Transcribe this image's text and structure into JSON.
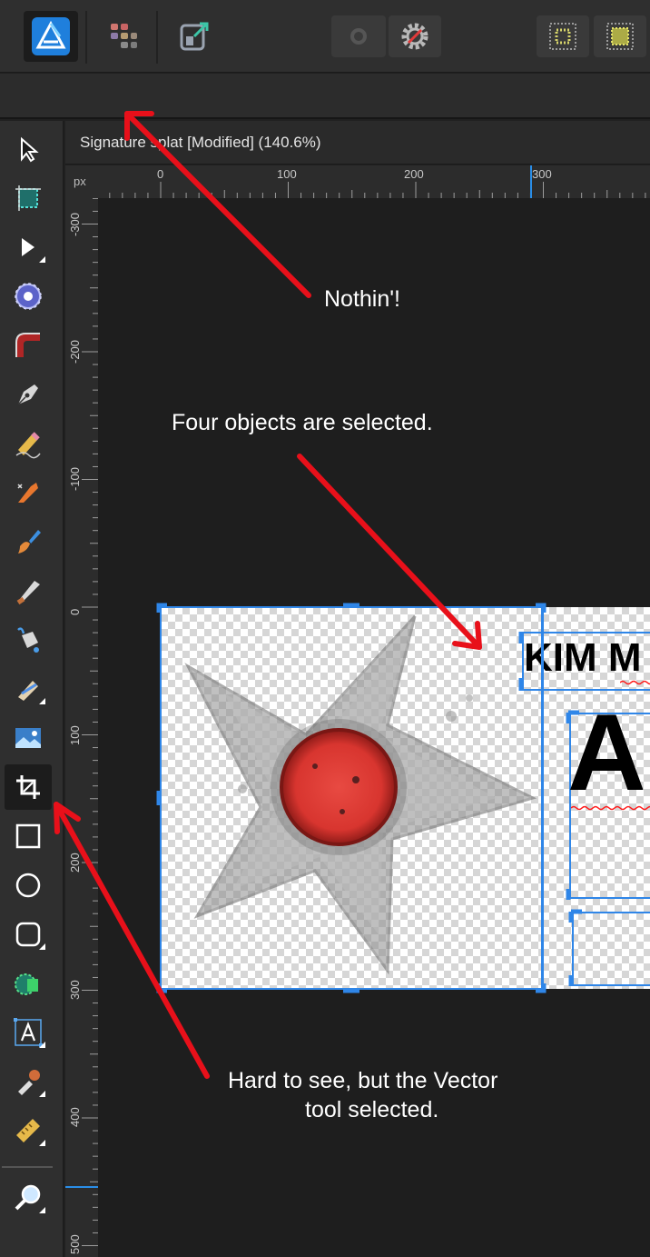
{
  "toolbar": {
    "items": [
      {
        "icon": "affinity-designer-persona-icon",
        "active": true
      },
      {
        "icon": "pixel-persona-icon"
      },
      {
        "icon": "export-persona-icon"
      },
      {
        "icon": "record-icon"
      },
      {
        "icon": "gear-no-snap-icon"
      },
      {
        "icon": "grid-icon"
      },
      {
        "icon": "grid-yellow-icon"
      }
    ]
  },
  "document": {
    "title": "Signature splat [Modified] (140.6%)",
    "ruler_unit": "px",
    "h_ticks": [
      "0",
      "100",
      "200",
      "300"
    ],
    "v_ticks": [
      "-300",
      "-200",
      "-100",
      "0",
      "100",
      "200",
      "300",
      "400",
      "500"
    ]
  },
  "canvas_content": {
    "text_top": "KIM M",
    "text_big": "A"
  },
  "tools": [
    {
      "name": "move-tool",
      "icon": "move-pointer-icon"
    },
    {
      "name": "artboard-tool",
      "icon": "artboard-icon"
    },
    {
      "name": "node-tool",
      "icon": "node-pointer-icon"
    },
    {
      "name": "point-transform-tool",
      "icon": "point-transform-icon"
    },
    {
      "name": "corner-tool",
      "icon": "corner-icon"
    },
    {
      "name": "pen-tool",
      "icon": "pen-icon"
    },
    {
      "name": "pencil-tool",
      "icon": "pencil-icon"
    },
    {
      "name": "vector-brush-tool",
      "icon": "vector-brush-icon"
    },
    {
      "name": "brush-tool",
      "icon": "paint-brush-icon"
    },
    {
      "name": "knife-tool",
      "icon": "knife-icon"
    },
    {
      "name": "fill-tool",
      "icon": "paint-bucket-icon"
    },
    {
      "name": "transparency-tool",
      "icon": "transparency-icon"
    },
    {
      "name": "place-image-tool",
      "icon": "image-icon"
    },
    {
      "name": "vector-crop-tool",
      "icon": "crop-icon",
      "selected": true
    },
    {
      "name": "rectangle-tool",
      "icon": "rectangle-icon"
    },
    {
      "name": "ellipse-tool",
      "icon": "ellipse-icon"
    },
    {
      "name": "rounded-rectangle-tool",
      "icon": "rounded-rectangle-icon"
    },
    {
      "name": "shape-builder-tool",
      "icon": "shape-builder-icon"
    },
    {
      "name": "artistic-text-tool",
      "icon": "text-frame-icon"
    },
    {
      "name": "color-picker-tool",
      "icon": "eyedropper-icon"
    },
    {
      "name": "measure-tool",
      "icon": "ruler-icon"
    },
    {
      "name": "zoom-tool",
      "icon": "zoom-icon"
    }
  ],
  "annotations": {
    "nothin": "Nothin'!",
    "four_objects": "Four objects are selected.",
    "vector_line1": "Hard to see, but the Vector",
    "vector_line2": "tool selected."
  },
  "colors": {
    "arrow": "#e8101a",
    "selection": "#2f86e8",
    "accent_blue": "#2a8ee8"
  }
}
